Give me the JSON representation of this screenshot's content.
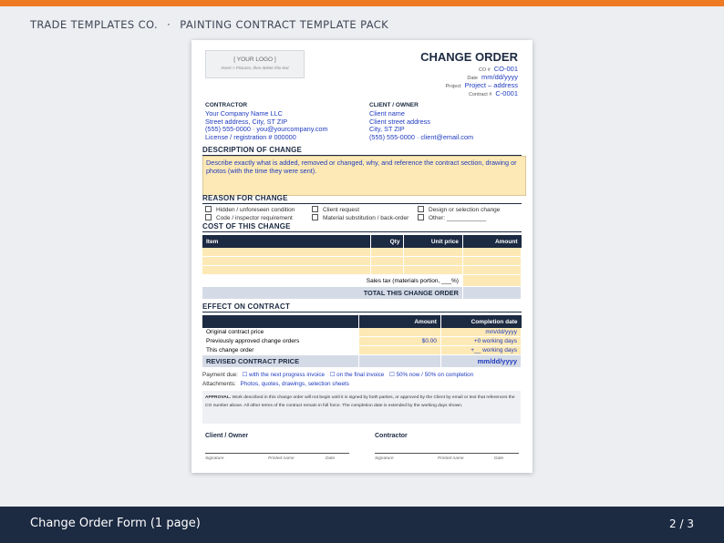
{
  "header": {
    "brand": "TRADE TEMPLATES CO.",
    "separator": "·",
    "pack": "PAINTING CONTRACT TEMPLATE PACK"
  },
  "footer": {
    "title": "Change Order Form (1 page)",
    "page": "2 / 3"
  },
  "colors": {
    "accent": "#ee7a24",
    "navy": "#1c2a42",
    "fill_yellow": "#fde9b5",
    "blue_text": "#1f3bbf"
  },
  "doc": {
    "logo": {
      "text": "[ YOUR LOGO ]",
      "hint": "Insert > Pictures, then delete this text"
    },
    "title": "CHANGE ORDER",
    "meta": [
      {
        "label": "CO #",
        "value": "CO-001"
      },
      {
        "label": "Date",
        "value": "mm/dd/yyyy"
      },
      {
        "label": "Project",
        "value": "Project – address"
      },
      {
        "label": "Contract #",
        "value": "C-0001"
      }
    ],
    "contractor": {
      "label": "CONTRACTOR",
      "lines": [
        "Your Company Name LLC",
        "Street address, City, ST ZIP",
        "(555) 555-0000 · you@yourcompany.com",
        "License / registration # 000000"
      ]
    },
    "client": {
      "label": "CLIENT / OWNER",
      "lines": [
        "Client name",
        "Client street address",
        "City, ST ZIP",
        "(555) 555-0000 · client@email.com"
      ]
    },
    "description": {
      "heading": "DESCRIPTION OF CHANGE",
      "text": "Describe exactly what is added, removed or changed, why, and reference the contract section, drawing or photos (with the time they were sent)."
    },
    "reason": {
      "heading": "REASON FOR CHANGE",
      "options": [
        "Hidden / unforeseen condition",
        "Client request",
        "Design or selection change",
        "Code / inspector requirement",
        "Material substitution / back-order",
        "Other: ____________"
      ]
    },
    "cost": {
      "heading": "COST OF THIS CHANGE",
      "columns": [
        "Item",
        "Qty",
        "Unit price",
        "Amount"
      ],
      "tax_label": "Sales tax (materials portion, ___%)",
      "total_label": "TOTAL THIS CHANGE ORDER"
    },
    "effect": {
      "heading": "EFFECT ON CONTRACT",
      "columns": [
        "",
        "Amount",
        "Completion date"
      ],
      "rows": [
        {
          "label": "Original contract price",
          "amount": "",
          "date": "mm/dd/yyyy"
        },
        {
          "label": "Previously approved change orders",
          "amount": "$0.00",
          "date": "+0 working days"
        },
        {
          "label": "This change order",
          "amount": "",
          "date": "+__ working days"
        }
      ],
      "revised_label": "REVISED CONTRACT PRICE",
      "revised_date": "mm/dd/yyyy"
    },
    "payment": {
      "label": "Payment due:",
      "options": [
        "with the next progress invoice",
        "on the final invoice",
        "50% now / 50% on completion"
      ]
    },
    "attachments": {
      "label": "Attachments:",
      "value": "Photos, quotes, drawings, selection sheets"
    },
    "approval": {
      "label": "APPROVAL.",
      "text": "Work described in this change order will not begin until it is signed by both parties, or approved by the Client by email or text that references the CO number above. All other terms of the contract remain in full force. The completion date is extended by the working days shown."
    },
    "signatures": {
      "client_label": "Client / Owner",
      "contractor_label": "Contractor",
      "fields": [
        "Signature",
        "Printed name",
        "Date"
      ]
    }
  }
}
